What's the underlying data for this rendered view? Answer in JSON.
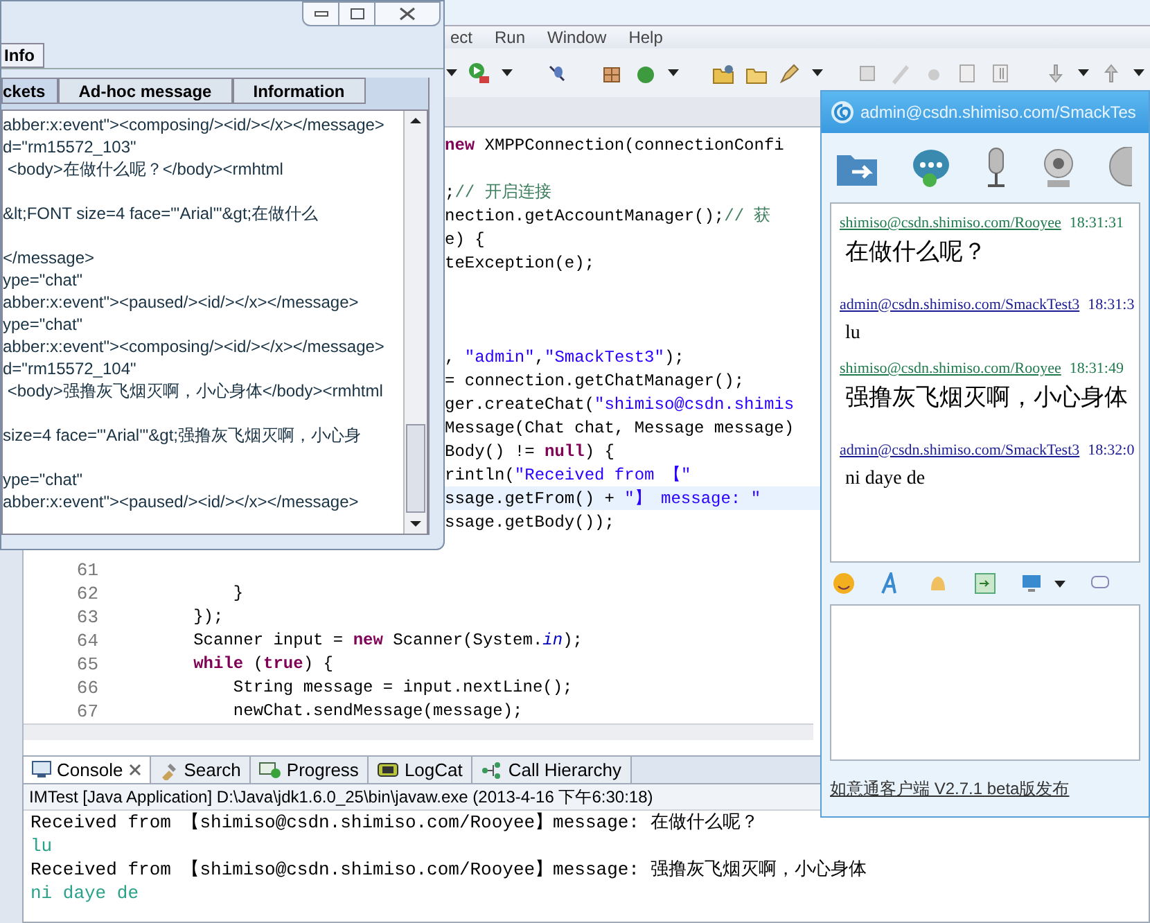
{
  "ide": {
    "menu": [
      "ect",
      "Run",
      "Window",
      "Help"
    ],
    "code_lines": [
      {
        "kind": "code",
        "segments": [
          {
            "kind": "keyword",
            "text": "new"
          },
          {
            "kind": "plain",
            "text": " XMPPConnection(connectionConfi"
          }
        ]
      },
      {
        "kind": "blank"
      },
      {
        "kind": "code",
        "segments": [
          {
            "kind": "plain",
            "text": ";"
          },
          {
            "kind": "comment",
            "text": "// 开启连接"
          }
        ]
      },
      {
        "kind": "code",
        "segments": [
          {
            "kind": "plain",
            "text": "nection.getAccountManager();"
          },
          {
            "kind": "comment",
            "text": "// 获"
          }
        ]
      },
      {
        "kind": "code",
        "segments": [
          {
            "kind": "plain",
            "text": "e) {"
          }
        ]
      },
      {
        "kind": "code",
        "segments": [
          {
            "kind": "plain",
            "text": "teException(e);"
          }
        ]
      },
      {
        "kind": "blank"
      },
      {
        "kind": "blank"
      },
      {
        "kind": "blank"
      },
      {
        "kind": "code",
        "segments": [
          {
            "kind": "plain",
            "text": ", "
          },
          {
            "kind": "string",
            "text": "\"admin\""
          },
          {
            "kind": "plain",
            "text": ","
          },
          {
            "kind": "string",
            "text": "\"SmackTest3\""
          },
          {
            "kind": "plain",
            "text": ");"
          }
        ]
      },
      {
        "kind": "code",
        "segments": [
          {
            "kind": "plain",
            "text": "= connection.getChatManager();"
          }
        ]
      },
      {
        "kind": "code",
        "segments": [
          {
            "kind": "plain",
            "text": "ger.createChat("
          },
          {
            "kind": "string",
            "text": "\"shimiso@csdn.shimis"
          }
        ]
      },
      {
        "kind": "code",
        "segments": [
          {
            "kind": "plain",
            "text": "Message(Chat chat, Message message)"
          }
        ]
      },
      {
        "kind": "code",
        "segments": [
          {
            "kind": "plain",
            "text": "Body() != "
          },
          {
            "kind": "keyword",
            "text": "null"
          },
          {
            "kind": "plain",
            "text": ") {"
          }
        ]
      },
      {
        "kind": "code",
        "segments": [
          {
            "kind": "plain",
            "text": "rintln("
          },
          {
            "kind": "string",
            "text": "\"Received from 【\""
          }
        ]
      },
      {
        "kind": "code",
        "current": true,
        "segments": [
          {
            "kind": "plain",
            "text": "ssage.getFrom() + "
          },
          {
            "kind": "string",
            "text": "\"】 message: \""
          }
        ]
      },
      {
        "kind": "code",
        "segments": [
          {
            "kind": "plain",
            "text": "ssage.getBody());"
          }
        ]
      },
      {
        "kind": "blank"
      },
      {
        "kind": "blank",
        "number": "61"
      },
      {
        "kind": "code",
        "number": "62",
        "segments": [
          {
            "kind": "plain",
            "text": "            }"
          }
        ]
      },
      {
        "kind": "code",
        "number": "63",
        "segments": [
          {
            "kind": "plain",
            "text": "        });"
          }
        ]
      },
      {
        "kind": "code",
        "number": "64",
        "segments": [
          {
            "kind": "plain",
            "text": "        Scanner input = "
          },
          {
            "kind": "keyword",
            "text": "new"
          },
          {
            "kind": "plain",
            "text": " Scanner(System."
          },
          {
            "kind": "static",
            "text": "in"
          },
          {
            "kind": "plain",
            "text": ");"
          }
        ]
      },
      {
        "kind": "code",
        "number": "65",
        "segments": [
          {
            "kind": "keyword",
            "text": "        while"
          },
          {
            "kind": "plain",
            "text": " ("
          },
          {
            "kind": "keyword",
            "text": "true"
          },
          {
            "kind": "plain",
            "text": ") {"
          }
        ]
      },
      {
        "kind": "code",
        "number": "66",
        "segments": [
          {
            "kind": "plain",
            "text": "            String message = input.nextLine();"
          }
        ]
      },
      {
        "kind": "code",
        "number": "67",
        "segments": [
          {
            "kind": "plain",
            "text": "            newChat.sendMessage(message);"
          }
        ]
      }
    ],
    "console": {
      "tabs": [
        {
          "label": "Console",
          "selected": true
        },
        {
          "label": "Search",
          "selected": false
        },
        {
          "label": "Progress",
          "selected": false
        },
        {
          "label": "LogCat",
          "selected": false
        },
        {
          "label": "Call Hierarchy",
          "selected": false
        }
      ],
      "header": "IMTest [Java Application] D:\\Java\\jdk1.6.0_25\\bin\\javaw.exe (2013-4-16 下午6:30:18)",
      "lines": [
        {
          "kind": "output",
          "text": "Received from 【shimiso@csdn.shimiso.com/Rooyee】message: 在做什么呢？"
        },
        {
          "kind": "input",
          "text": "lu"
        },
        {
          "kind": "output",
          "text": "Received from 【shimiso@csdn.shimiso.com/Rooyee】message: 强撸灰飞烟灭啊，小心身体"
        },
        {
          "kind": "input",
          "text": "ni daye de"
        }
      ]
    }
  },
  "debugger": {
    "tabs": [
      {
        "label": "Info",
        "selected": true
      }
    ],
    "subtabs": [
      {
        "label": "ckets",
        "selected": true
      },
      {
        "label": "Ad-hoc message",
        "selected": false
      },
      {
        "label": "Information",
        "selected": false
      }
    ],
    "lines": [
      {
        "text": "abber:x:event\"><composing/><id/></x></message>"
      },
      {
        "text": "d=\"rm15572_103\""
      },
      {
        "text": " <body>在做什么呢？</body><rmhtml",
        "spaced": true
      },
      {
        "text": "&lt;FONT size=4 face=\"'Arial'\"&gt;在做什么",
        "spaced": true
      },
      {
        "text": "</message>"
      },
      {
        "text": "ype=\"chat\""
      },
      {
        "text": "abber:x:event\"><paused/><id/></x></message>"
      },
      {
        "text": "ype=\"chat\""
      },
      {
        "text": "abber:x:event\"><composing/><id/></x></message>"
      },
      {
        "text": "d=\"rm15572_104\""
      },
      {
        "text": " <body>强撸灰飞烟灭啊，小心身体</body><rmhtml",
        "spaced": true
      },
      {
        "text": "size=4 face=\"'Arial'\"&gt;强撸灰飞烟灭啊，小心身",
        "spaced": true
      },
      {
        "text": "ype=\"chat\""
      },
      {
        "text": "abber:x:event\"><paused/><id/></x></message>"
      }
    ]
  },
  "chat": {
    "title": "admin@csdn.shimiso.com/SmackTes",
    "messages": [
      {
        "sender": "shimiso@csdn.shimiso.com/Rooyee",
        "time": "18:31:31",
        "color": "#1f7a4d",
        "kind": "received",
        "body": "在做什么呢？"
      },
      {
        "sender": "admin@csdn.shimiso.com/SmackTest3",
        "time": "18:31:3",
        "color": "#1c1c94",
        "kind": "sent",
        "body": "lu"
      },
      {
        "sender": "shimiso@csdn.shimiso.com/Rooyee",
        "time": "18:31:49",
        "color": "#1f7a4d",
        "kind": "received",
        "body": "强撸灰飞烟灭啊，小心身体"
      },
      {
        "sender": "admin@csdn.shimiso.com/SmackTest3",
        "time": "18:32:0",
        "color": "#1c1c94",
        "kind": "sent",
        "body": "ni daye de"
      }
    ],
    "footer": "如意通客户端 V2.7.1 beta版发布"
  }
}
